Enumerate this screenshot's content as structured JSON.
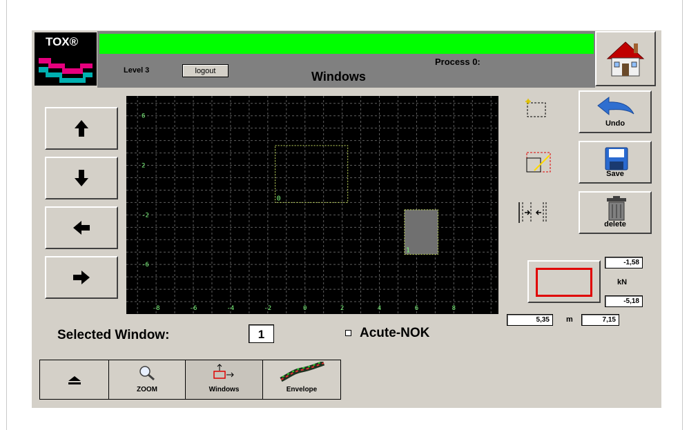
{
  "header": {
    "logo_text": "TOX®",
    "level": "Level 3",
    "logout_label": "logout",
    "title": "Windows",
    "process": "Process 0:"
  },
  "plot": {
    "x_ticks": [
      "-8",
      "-6",
      "-4",
      "-2",
      "0",
      "2",
      "4",
      "6",
      "8"
    ],
    "y_ticks": [
      "6",
      "2",
      "-2",
      "-6"
    ],
    "windows": [
      {
        "label": "0",
        "x_range": [
          -1.6,
          2.3
        ],
        "y_range": [
          -1.0,
          3.6
        ],
        "selected": false
      },
      {
        "label": "1",
        "x_range": [
          5.35,
          7.15
        ],
        "y_range": [
          -5.18,
          -1.58
        ],
        "selected": true
      }
    ]
  },
  "side": {
    "undo_label": "Undo",
    "save_label": "Save",
    "delete_label": "delete",
    "force_top": "-1,58",
    "force_bottom": "-5,18",
    "force_unit": "kN",
    "pos_left": "5,35",
    "pos_unit": "m",
    "pos_right": "7,15"
  },
  "bottom": {
    "selected_window_label": "Selected Window:",
    "selected_window_value": "1",
    "acute_label": "Acute-NOK"
  },
  "tabs": {
    "zoom_label": "ZOOM",
    "windows_label": "Windows",
    "envelope_label": "Envelope"
  },
  "colors": {
    "status_bar": "#00ff00",
    "grid": "#606060",
    "window_outline": "#c8e060",
    "axis_label": "#80ff80"
  }
}
